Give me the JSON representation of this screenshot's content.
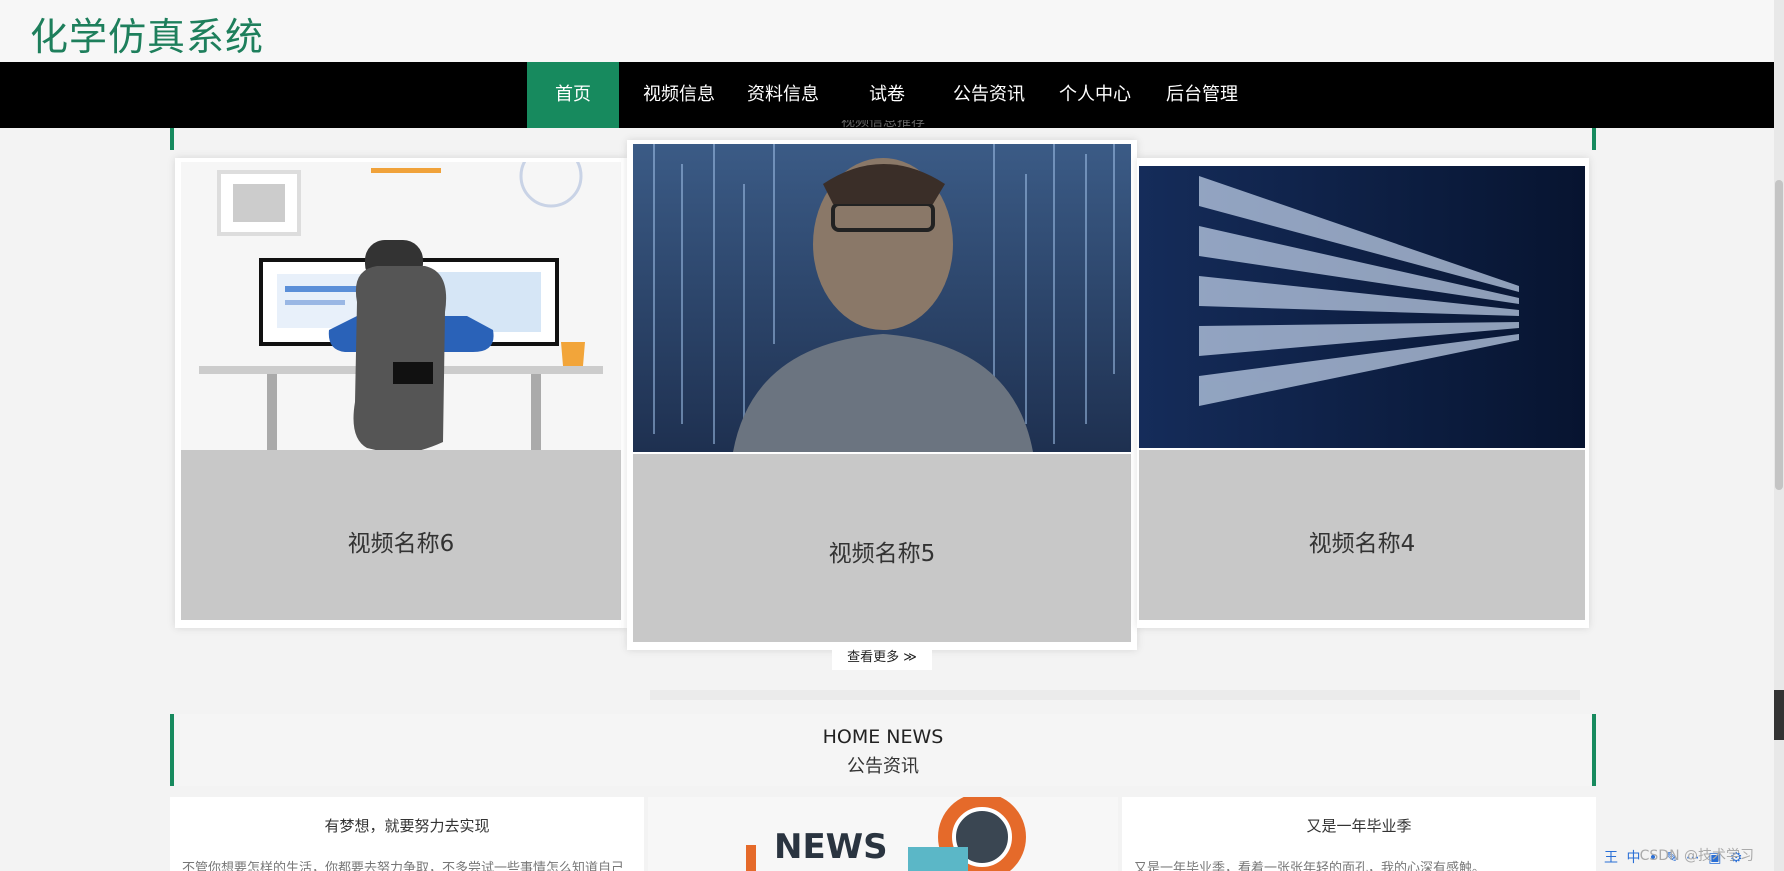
{
  "header": {
    "title": "化学仿真系统"
  },
  "nav": {
    "items": [
      {
        "label": "首页",
        "active": true
      },
      {
        "label": "视频信息"
      },
      {
        "label": "资料信息"
      },
      {
        "label": "试卷"
      },
      {
        "label": "公告资讯"
      },
      {
        "label": "个人中心"
      },
      {
        "label": "后台管理"
      }
    ]
  },
  "video_section": {
    "title": "视频信息推荐",
    "cards": [
      {
        "name": "视频名称6"
      },
      {
        "name": "视频名称5"
      },
      {
        "name": "视频名称4"
      }
    ],
    "more_label": "查看更多 ≫"
  },
  "news_section": {
    "title_en": "HOME NEWS",
    "title_cn": "公告资讯",
    "cards": [
      {
        "title": "有梦想，就要努力去实现",
        "snippet": "不管你想要怎样的生活，你都要去努力争取，不多尝试一些事情怎么知道自己"
      },
      {
        "title": "",
        "image_text": "NEWS"
      },
      {
        "title": "又是一年毕业季",
        "snippet": "又是一年毕业季，看着一张张年轻的面孔，我的心深有感触。"
      }
    ]
  },
  "watermark": {
    "text": "CSDN @技术学习"
  },
  "colors": {
    "brand": "#178a5e",
    "nav_bg": "#000000",
    "caption_bg": "#c8c8c8"
  }
}
